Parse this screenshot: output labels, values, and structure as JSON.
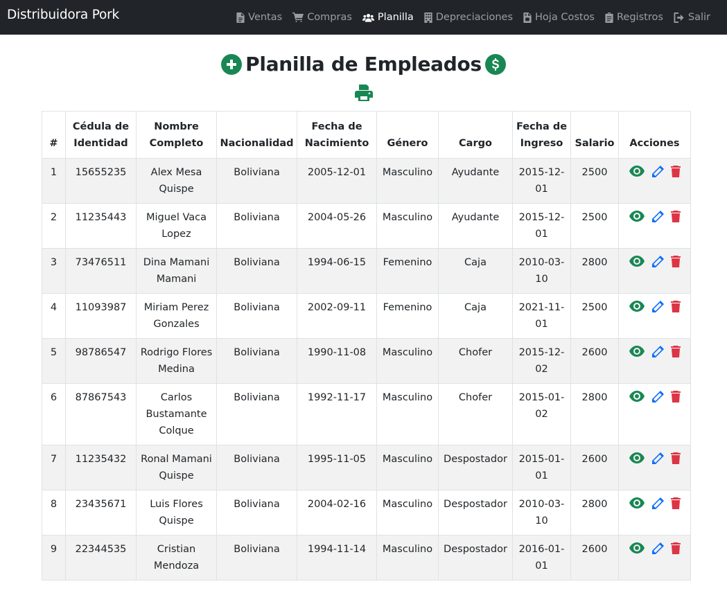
{
  "navbar": {
    "brand": "Distribuidora Pork",
    "items": [
      {
        "label": "Ventas",
        "icon": "file-icon"
      },
      {
        "label": "Compras",
        "icon": "cart-icon"
      },
      {
        "label": "Planilla",
        "icon": "users-icon",
        "active": true
      },
      {
        "label": "Depreciaciones",
        "icon": "building-icon"
      },
      {
        "label": "Hoja Costos",
        "icon": "file-invoice-icon"
      },
      {
        "label": "Registros",
        "icon": "clipboard-icon"
      },
      {
        "label": "Salir",
        "icon": "sign-out-icon"
      }
    ]
  },
  "page": {
    "title": "Planilla de Empleados",
    "add_icon": "plus-circle-icon",
    "pay_icon": "dollar-circle-icon",
    "print_icon": "printer-icon"
  },
  "colors": {
    "navbar_bg": "#212529",
    "success": "#198754",
    "primary": "#0d6efd",
    "danger": "#dc3545"
  },
  "table": {
    "headers": [
      "#",
      "Cédula de Identidad",
      "Nombre Completo",
      "Nacionalidad",
      "Fecha de Nacimiento",
      "Género",
      "Cargo",
      "Fecha de Ingreso",
      "Salario",
      "Acciones"
    ],
    "rows": [
      [
        "1",
        "15655235",
        "Alex Mesa Quispe",
        "Boliviana",
        "2005-12-01",
        "Masculino",
        "Ayudante",
        "2015-12-01",
        "2500"
      ],
      [
        "2",
        "11235443",
        "Miguel Vaca Lopez",
        "Boliviana",
        "2004-05-26",
        "Masculino",
        "Ayudante",
        "2015-12-01",
        "2500"
      ],
      [
        "3",
        "73476511",
        "Dina Mamani Mamani",
        "Boliviana",
        "1994-06-15",
        "Femenino",
        "Caja",
        "2010-03-10",
        "2800"
      ],
      [
        "4",
        "11093987",
        "Miriam Perez Gonzales",
        "Boliviana",
        "2002-09-11",
        "Femenino",
        "Caja",
        "2021-11-01",
        "2500"
      ],
      [
        "5",
        "98786547",
        "Rodrigo Flores Medina",
        "Boliviana",
        "1990-11-08",
        "Masculino",
        "Chofer",
        "2015-12-02",
        "2600"
      ],
      [
        "6",
        "87867543",
        "Carlos Bustamante Colque",
        "Boliviana",
        "1992-11-17",
        "Masculino",
        "Chofer",
        "2015-01-02",
        "2800"
      ],
      [
        "7",
        "11235432",
        "Ronal Mamani Quispe",
        "Boliviana",
        "1995-11-05",
        "Masculino",
        "Despostador",
        "2015-01-01",
        "2600"
      ],
      [
        "8",
        "23435671",
        "Luis Flores Quispe",
        "Boliviana",
        "2004-02-16",
        "Masculino",
        "Despostador",
        "2010-03-10",
        "2800"
      ],
      [
        "9",
        "22344535",
        "Cristian Mendoza",
        "Boliviana",
        "1994-11-14",
        "Masculino",
        "Despostador",
        "2016-01-01",
        "2600"
      ]
    ],
    "action_icons": [
      "eye-icon",
      "pencil-icon",
      "trash-icon"
    ]
  }
}
